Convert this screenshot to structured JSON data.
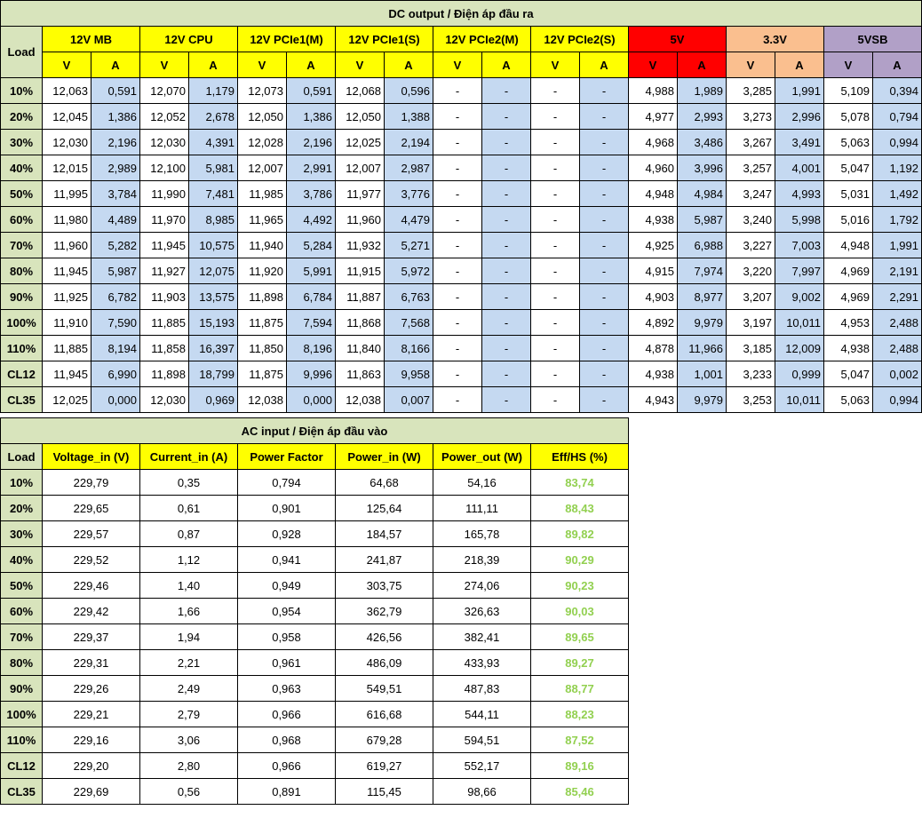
{
  "dc": {
    "title": "DC output / Điện áp đầu ra",
    "load_label": "Load",
    "groups": [
      "12V MB",
      "12V CPU",
      "12V PCIe1(M)",
      "12V PCIe1(S)",
      "12V PCIe2(M)",
      "12V PCIe2(S)",
      "5V",
      "3.3V",
      "5VSB"
    ],
    "v_label": "V",
    "a_label": "A",
    "rows": [
      {
        "load": "10%",
        "vals": [
          "12,063",
          "0,591",
          "12,070",
          "1,179",
          "12,073",
          "0,591",
          "12,068",
          "0,596",
          "-",
          "-",
          "-",
          "-",
          "4,988",
          "1,989",
          "3,285",
          "1,991",
          "5,109",
          "0,394"
        ]
      },
      {
        "load": "20%",
        "vals": [
          "12,045",
          "1,386",
          "12,052",
          "2,678",
          "12,050",
          "1,386",
          "12,050",
          "1,388",
          "-",
          "-",
          "-",
          "-",
          "4,977",
          "2,993",
          "3,273",
          "2,996",
          "5,078",
          "0,794"
        ]
      },
      {
        "load": "30%",
        "vals": [
          "12,030",
          "2,196",
          "12,030",
          "4,391",
          "12,028",
          "2,196",
          "12,025",
          "2,194",
          "-",
          "-",
          "-",
          "-",
          "4,968",
          "3,486",
          "3,267",
          "3,491",
          "5,063",
          "0,994"
        ]
      },
      {
        "load": "40%",
        "vals": [
          "12,015",
          "2,989",
          "12,100",
          "5,981",
          "12,007",
          "2,991",
          "12,007",
          "2,987",
          "-",
          "-",
          "-",
          "-",
          "4,960",
          "3,996",
          "3,257",
          "4,001",
          "5,047",
          "1,192"
        ]
      },
      {
        "load": "50%",
        "vals": [
          "11,995",
          "3,784",
          "11,990",
          "7,481",
          "11,985",
          "3,786",
          "11,977",
          "3,776",
          "-",
          "-",
          "-",
          "-",
          "4,948",
          "4,984",
          "3,247",
          "4,993",
          "5,031",
          "1,492"
        ]
      },
      {
        "load": "60%",
        "vals": [
          "11,980",
          "4,489",
          "11,970",
          "8,985",
          "11,965",
          "4,492",
          "11,960",
          "4,479",
          "-",
          "-",
          "-",
          "-",
          "4,938",
          "5,987",
          "3,240",
          "5,998",
          "5,016",
          "1,792"
        ]
      },
      {
        "load": "70%",
        "vals": [
          "11,960",
          "5,282",
          "11,945",
          "10,575",
          "11,940",
          "5,284",
          "11,932",
          "5,271",
          "-",
          "-",
          "-",
          "-",
          "4,925",
          "6,988",
          "3,227",
          "7,003",
          "4,948",
          "1,991"
        ]
      },
      {
        "load": "80%",
        "vals": [
          "11,945",
          "5,987",
          "11,927",
          "12,075",
          "11,920",
          "5,991",
          "11,915",
          "5,972",
          "-",
          "-",
          "-",
          "-",
          "4,915",
          "7,974",
          "3,220",
          "7,997",
          "4,969",
          "2,191"
        ]
      },
      {
        "load": "90%",
        "vals": [
          "11,925",
          "6,782",
          "11,903",
          "13,575",
          "11,898",
          "6,784",
          "11,887",
          "6,763",
          "-",
          "-",
          "-",
          "-",
          "4,903",
          "8,977",
          "3,207",
          "9,002",
          "4,969",
          "2,291"
        ]
      },
      {
        "load": "100%",
        "vals": [
          "11,910",
          "7,590",
          "11,885",
          "15,193",
          "11,875",
          "7,594",
          "11,868",
          "7,568",
          "-",
          "-",
          "-",
          "-",
          "4,892",
          "9,979",
          "3,197",
          "10,011",
          "4,953",
          "2,488"
        ]
      },
      {
        "load": "110%",
        "vals": [
          "11,885",
          "8,194",
          "11,858",
          "16,397",
          "11,850",
          "8,196",
          "11,840",
          "8,166",
          "-",
          "-",
          "-",
          "-",
          "4,878",
          "11,966",
          "3,185",
          "12,009",
          "4,938",
          "2,488"
        ]
      },
      {
        "load": "CL12",
        "vals": [
          "11,945",
          "6,990",
          "11,898",
          "18,799",
          "11,875",
          "9,996",
          "11,863",
          "9,958",
          "-",
          "-",
          "-",
          "-",
          "4,938",
          "1,001",
          "3,233",
          "0,999",
          "5,047",
          "0,002"
        ]
      },
      {
        "load": "CL35",
        "vals": [
          "12,025",
          "0,000",
          "12,030",
          "0,969",
          "12,038",
          "0,000",
          "12,038",
          "0,007",
          "-",
          "-",
          "-",
          "-",
          "4,943",
          "9,979",
          "3,253",
          "10,011",
          "5,063",
          "0,994"
        ]
      }
    ]
  },
  "ac": {
    "title": "AC input / Điện áp đầu vào",
    "headers": [
      "Load",
      "Voltage_in (V)",
      "Current_in (A)",
      "Power Factor",
      "Power_in (W)",
      "Power_out (W)",
      "Eff/HS (%)"
    ],
    "rows": [
      [
        "10%",
        "229,79",
        "0,35",
        "0,794",
        "64,68",
        "54,16",
        "83,74"
      ],
      [
        "20%",
        "229,65",
        "0,61",
        "0,901",
        "125,64",
        "111,11",
        "88,43"
      ],
      [
        "30%",
        "229,57",
        "0,87",
        "0,928",
        "184,57",
        "165,78",
        "89,82"
      ],
      [
        "40%",
        "229,52",
        "1,12",
        "0,941",
        "241,87",
        "218,39",
        "90,29"
      ],
      [
        "50%",
        "229,46",
        "1,40",
        "0,949",
        "303,75",
        "274,06",
        "90,23"
      ],
      [
        "60%",
        "229,42",
        "1,66",
        "0,954",
        "362,79",
        "326,63",
        "90,03"
      ],
      [
        "70%",
        "229,37",
        "1,94",
        "0,958",
        "426,56",
        "382,41",
        "89,65"
      ],
      [
        "80%",
        "229,31",
        "2,21",
        "0,961",
        "486,09",
        "433,93",
        "89,27"
      ],
      [
        "90%",
        "229,26",
        "2,49",
        "0,963",
        "549,51",
        "487,83",
        "88,77"
      ],
      [
        "100%",
        "229,21",
        "2,79",
        "0,966",
        "616,68",
        "544,11",
        "88,23"
      ],
      [
        "110%",
        "229,16",
        "3,06",
        "0,968",
        "679,28",
        "594,51",
        "87,52"
      ],
      [
        "CL12",
        "229,20",
        "2,80",
        "0,966",
        "619,27",
        "552,17",
        "89,16"
      ],
      [
        "CL35",
        "229,69",
        "0,56",
        "0,891",
        "115,45",
        "98,66",
        "85,46"
      ]
    ]
  },
  "colors": {
    "title_bg": "#d8e4bc",
    "rail_12v": "#ffff00",
    "rail_5v": "#ff0000",
    "rail_3v3": "#fabf8f",
    "rail_5vsb": "#b1a0c7",
    "amp_col": "#c5d9f1",
    "efficiency_text": "#92d050"
  }
}
